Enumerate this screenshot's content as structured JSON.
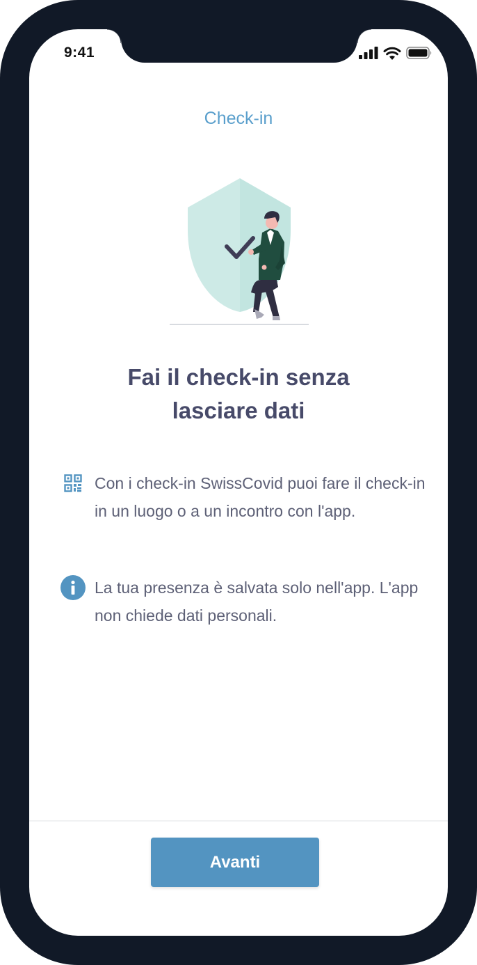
{
  "status_bar": {
    "time": "9:41"
  },
  "nav": {
    "title": "Check-in"
  },
  "headline": {
    "line1": "Fai il check-in senza",
    "line2": "lasciare dati"
  },
  "info_items": [
    {
      "icon": "qr-code-icon",
      "text": "Con i check-in SwissCovid puoi fare il check-in in un luogo o a un incontro con l'app."
    },
    {
      "icon": "info-icon",
      "text": "La tua presenza è salvata solo nell'app. L'app non chiede dati personali."
    }
  ],
  "footer": {
    "next_label": "Avanti"
  },
  "colors": {
    "accent": "#5394c1",
    "title": "#5a9fcc",
    "headline": "#474a69",
    "body_text": "#5d6076",
    "frame": "#111927"
  }
}
